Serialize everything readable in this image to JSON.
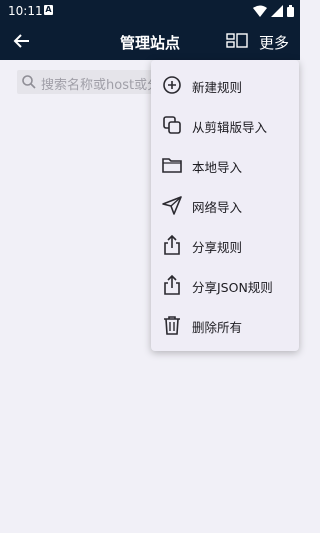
{
  "status_bar": {
    "time": "10:11",
    "notification_badge": "A"
  },
  "app_bar": {
    "title": "管理站点",
    "more_label": "更多"
  },
  "search": {
    "placeholder": "搜索名称或host或分组"
  },
  "menu": {
    "items": [
      {
        "label": "新建规则",
        "icon": "add-circle-icon"
      },
      {
        "label": "从剪辑版导入",
        "icon": "copy-icon"
      },
      {
        "label": "本地导入",
        "icon": "folder-icon"
      },
      {
        "label": "网络导入",
        "icon": "send-icon"
      },
      {
        "label": "分享规则",
        "icon": "share-icon"
      },
      {
        "label": "分享JSON规则",
        "icon": "share-icon"
      },
      {
        "label": "删除所有",
        "icon": "trash-icon"
      }
    ]
  },
  "colors": {
    "appbar": "#0b1d33",
    "background": "#f1f0f7",
    "menu": "#efedf6"
  }
}
